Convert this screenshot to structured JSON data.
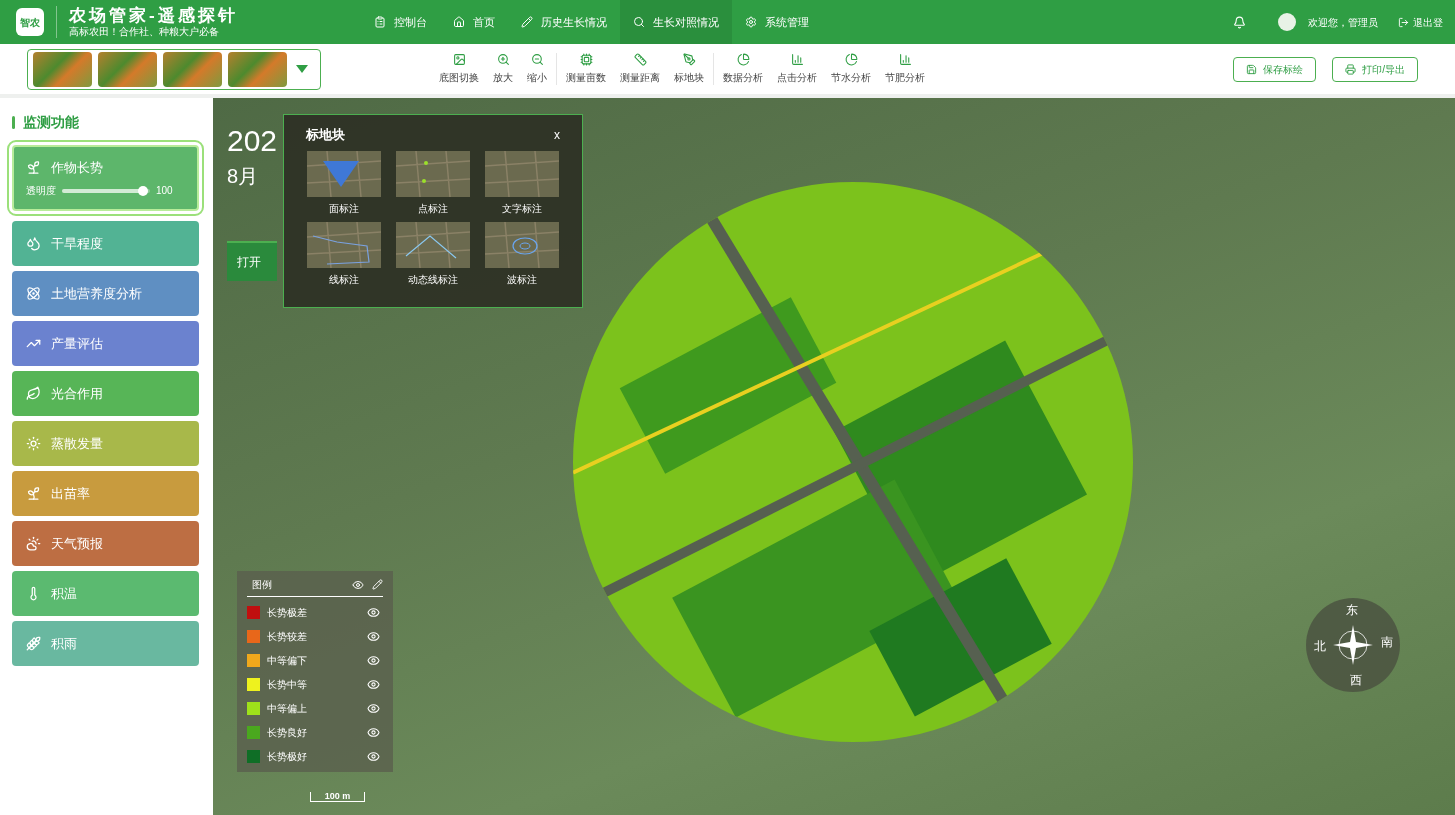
{
  "header": {
    "logo": "智农",
    "title": "农场管家-遥感探针",
    "subtitle": "高标农田！合作社、种粮大户必备",
    "nav": [
      {
        "label": "控制台",
        "selected": false
      },
      {
        "label": "首页",
        "selected": false
      },
      {
        "label": "历史生长情况",
        "selected": false
      },
      {
        "label": "生长对照情况",
        "selected": true
      },
      {
        "label": "系统管理",
        "selected": false
      }
    ],
    "user": "欢迎您，管理员",
    "logout": "退出登"
  },
  "toolbar": {
    "tool_groups": [
      [
        {
          "label": "底图切换",
          "kind": "image"
        },
        {
          "label": "放大",
          "kind": "zoom-in"
        },
        {
          "label": "缩小",
          "kind": "zoom-out"
        }
      ],
      [
        {
          "label": "测量亩数",
          "kind": "area"
        },
        {
          "label": "测量距离",
          "kind": "ruler"
        },
        {
          "label": "标地块",
          "kind": "pen"
        }
      ],
      [
        {
          "label": "数据分析",
          "kind": "pie"
        },
        {
          "label": "点击分析",
          "kind": "bars"
        },
        {
          "label": "节水分析",
          "kind": "pie"
        },
        {
          "label": "节肥分析",
          "kind": "bars"
        }
      ]
    ],
    "buttons": [
      {
        "label": "保存标绘",
        "kind": "save"
      },
      {
        "label": "打印/导出",
        "kind": "print"
      }
    ]
  },
  "sidebar": {
    "title": "监测功能",
    "items": [
      {
        "label": "作物长势",
        "color": "#5db66b",
        "selected": true,
        "opacity": {
          "label": "透明度",
          "level": 0.92,
          "reading": "100"
        }
      },
      {
        "label": "干旱程度",
        "color": "#52b394",
        "selected": false
      },
      {
        "label": "土地营养度分析",
        "color": "#5f8fc2",
        "selected": false
      },
      {
        "label": "产量评估",
        "color": "#6b82cf",
        "selected": false
      },
      {
        "label": "光合作用",
        "color": "#57b557",
        "selected": false
      },
      {
        "label": "蒸散发量",
        "color": "#a8b84a",
        "selected": false
      },
      {
        "label": "出苗率",
        "color": "#c89b3e",
        "selected": false
      },
      {
        "label": "天气预报",
        "color": "#bd6e43",
        "selected": false
      },
      {
        "label": "积温",
        "color": "#5bba70",
        "selected": false
      },
      {
        "label": "积雨",
        "color": "#69b8a0",
        "selected": false
      }
    ]
  },
  "map": {
    "date_year": "202",
    "date_month": "8月",
    "open_button": "打开",
    "popup": {
      "title": "标地块",
      "close": "x",
      "items": [
        {
          "label": "面标注",
          "kind": "area"
        },
        {
          "label": "点标注",
          "kind": "point"
        },
        {
          "label": "文字标注",
          "kind": "text"
        },
        {
          "label": "线标注",
          "kind": "line"
        },
        {
          "label": "动态线标注",
          "kind": "dynamic-line"
        },
        {
          "label": "波标注",
          "kind": "wave"
        }
      ]
    },
    "legend": {
      "title": "图例",
      "items": [
        {
          "label": "长势极差",
          "color": "#c00f0f",
          "visible": true
        },
        {
          "label": "长势较差",
          "color": "#e8671a",
          "visible": true
        },
        {
          "label": "中等偏下",
          "color": "#f0a81c",
          "visible": true
        },
        {
          "label": "长势中等",
          "color": "#eef21e",
          "visible": true
        },
        {
          "label": "中等偏上",
          "color": "#9ee11a",
          "visible": true
        },
        {
          "label": "长势良好",
          "color": "#4aa81e",
          "visible": true
        },
        {
          "label": "长势极好",
          "color": "#0f6e26",
          "visible": true
        }
      ]
    },
    "compass": {
      "top": "东",
      "right": "南",
      "bottom": "西",
      "left": "北"
    },
    "scale": "100 m"
  }
}
